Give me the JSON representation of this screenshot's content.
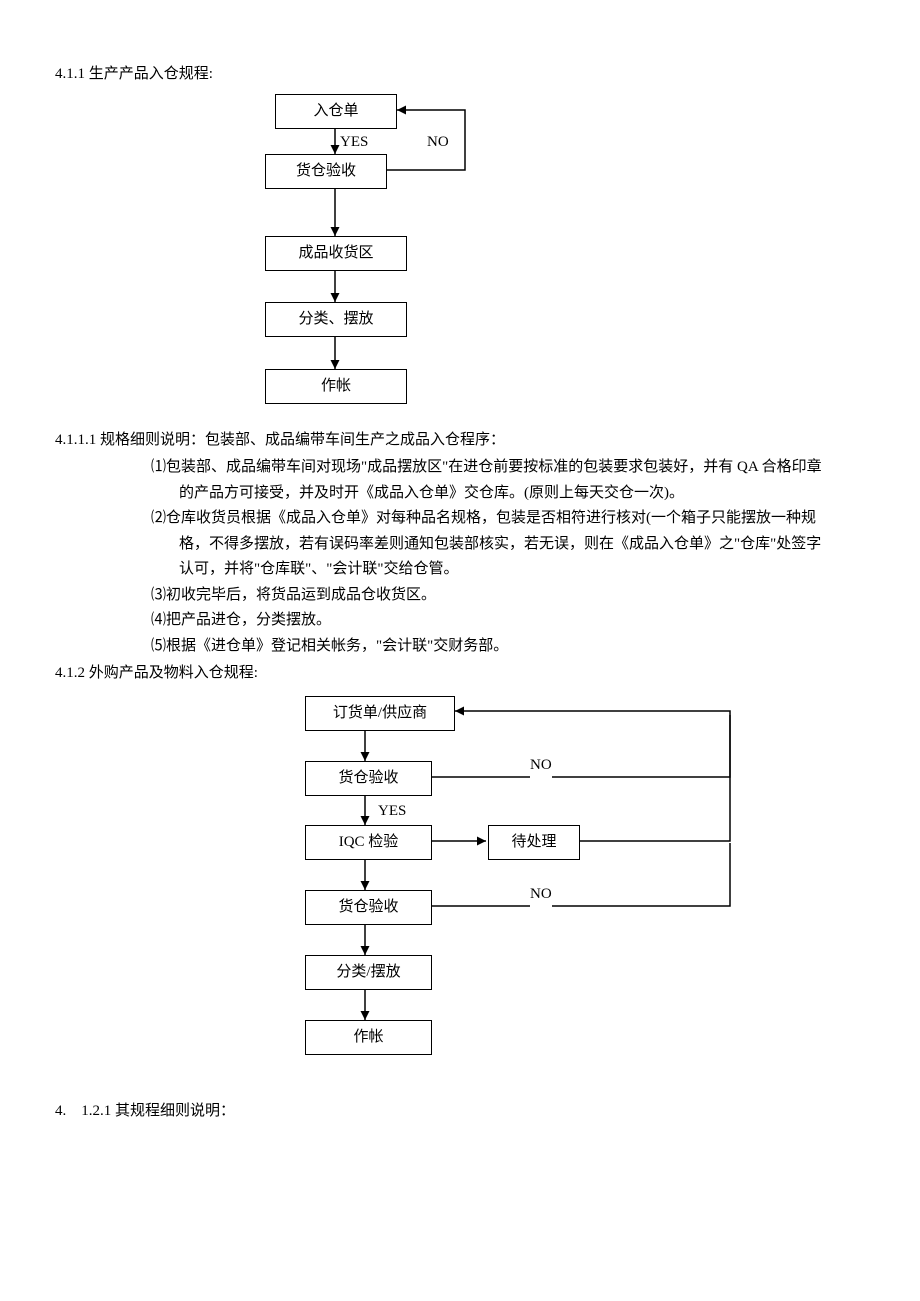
{
  "section1": {
    "title": "4.1.1 生产产品入仓规程:",
    "flow": {
      "b1": "入仓单",
      "b2": "货仓验收",
      "b3": "成品收货区",
      "b4": "分类、摆放",
      "b5": "作帐",
      "yes": "YES",
      "no": "NO"
    },
    "detail_title": "4.1.1.1 规格细则说明：包装部、成品编带车间生产之成品入仓程序：",
    "li1a": "⑴包装部、成品编带车间对现场\"成品摆放区\"在进仓前要按标准的包装要求包装好，并有 QA 合格印章",
    "li1b": "的产品方可接受，并及时开《成品入仓单》交仓库。(原则上每天交仓一次)。",
    "li2a": "⑵仓库收货员根据《成品入仓单》对每种品名规格，包装是否相符进行核对(一个箱子只能摆放一种规",
    "li2b": "格，不得多摆放，若有误码率差则通知包装部核实，若无误，则在《成品入仓单》之\"仓库\"处签字",
    "li2c": "认可，并将\"仓库联\"、\"会计联\"交给仓管。",
    "li3": "⑶初收完毕后，将货品运到成品仓收货区。",
    "li4": "⑷把产品进仓，分类摆放。",
    "li5": "⑸根据《进仓单》登记相关帐务，\"会计联\"交财务部。"
  },
  "section2": {
    "title": "4.1.2 外购产品及物料入仓规程:",
    "flow": {
      "b1": "订货单/供应商",
      "b2": "货仓验收",
      "b3": "IQC 检验",
      "b3b": "待处理",
      "b4": "货仓验收",
      "b5": "分类/摆放",
      "b6": "作帐",
      "yes": "YES",
      "no1": "NO",
      "no2": "NO"
    },
    "detail_title": "4.　1.2.1 其规程细则说明："
  }
}
